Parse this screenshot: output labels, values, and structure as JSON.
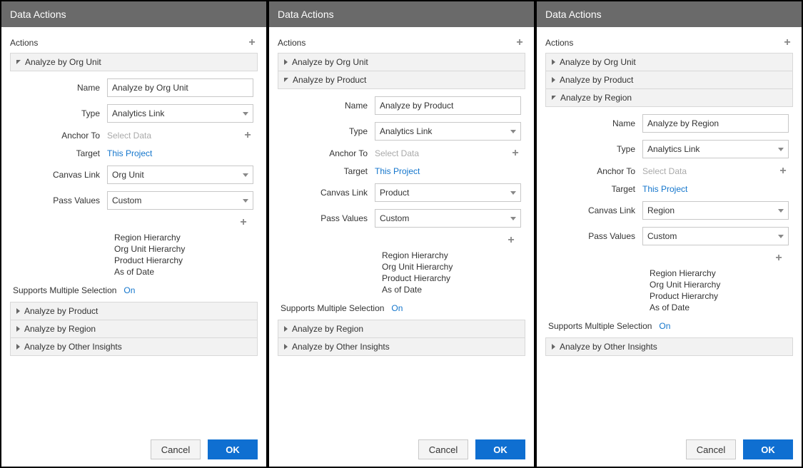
{
  "title": "Data Actions",
  "actionsLabel": "Actions",
  "labels": {
    "name": "Name",
    "type": "Type",
    "anchorTo": "Anchor To",
    "target": "Target",
    "canvasLink": "Canvas Link",
    "passValues": "Pass Values",
    "supportsMulti": "Supports Multiple Selection",
    "on": "On",
    "selectData": "Select Data",
    "thisProject": "This Project",
    "cancel": "Cancel",
    "ok": "OK"
  },
  "typeOption": "Analytics Link",
  "passValuesOption": "Custom",
  "valueList": [
    "Region Hierarchy",
    "Org Unit Hierarchy",
    "Product Hierarchy",
    "As of Date"
  ],
  "panels": [
    {
      "expandedIndex": 0,
      "items": [
        "Analyze by Org Unit",
        "Analyze by Product",
        "Analyze by Region",
        "Analyze by Other Insights"
      ],
      "form": {
        "name": "Analyze by Org Unit",
        "canvasLink": "Org Unit"
      }
    },
    {
      "expandedIndex": 1,
      "items": [
        "Analyze by Org Unit",
        "Analyze by Product",
        "Analyze by Region",
        "Analyze by Other Insights"
      ],
      "form": {
        "name": "Analyze by Product",
        "canvasLink": "Product"
      }
    },
    {
      "expandedIndex": 2,
      "items": [
        "Analyze by Org Unit",
        "Analyze by Product",
        "Analyze by Region",
        "Analyze by Other Insights"
      ],
      "form": {
        "name": "Analyze by Region",
        "canvasLink": "Region"
      }
    }
  ]
}
